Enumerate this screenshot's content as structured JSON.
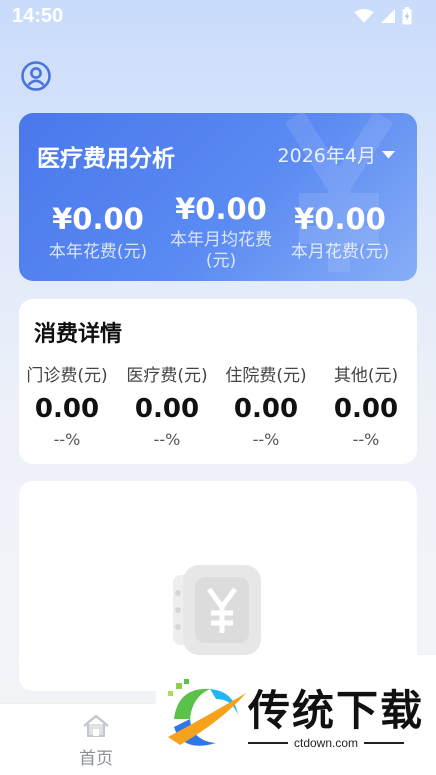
{
  "status_bar": {
    "time": "14:50"
  },
  "summary": {
    "title": "医疗费用分析",
    "date": "2026年4月",
    "stats": [
      {
        "value": "¥0.00",
        "label": "本年花费(元)"
      },
      {
        "value": "¥0.00",
        "label": "本年月均花费(元)"
      },
      {
        "value": "¥0.00",
        "label": "本月花费(元)"
      }
    ]
  },
  "details": {
    "title": "消费详情",
    "columns": [
      {
        "label": "门诊费(元)",
        "value": "0.00",
        "pct": "--%"
      },
      {
        "label": "医疗费(元)",
        "value": "0.00",
        "pct": "--%"
      },
      {
        "label": "住院费(元)",
        "value": "0.00",
        "pct": "--%"
      },
      {
        "label": "其他(元)",
        "value": "0.00",
        "pct": "--%"
      }
    ]
  },
  "nav": {
    "home_label": "首页"
  },
  "watermark": {
    "brand": "传统下载",
    "url": "ctdown.com"
  },
  "colors": {
    "accent": "#4a78ec",
    "background": "#eef2f8"
  }
}
